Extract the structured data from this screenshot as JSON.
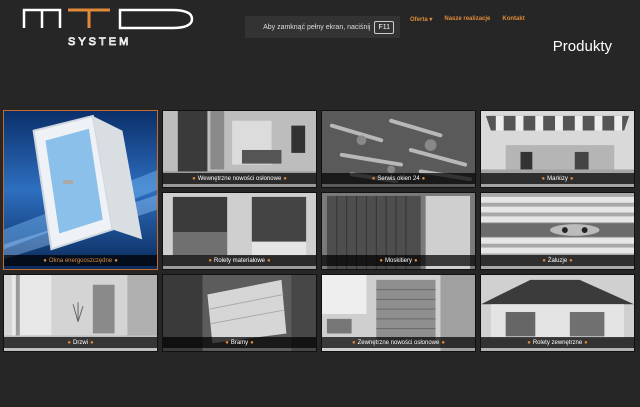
{
  "header": {
    "logo_text": "MTD SYSTEM",
    "fullscreen_notice": "Aby zamknąć pełny ekran, naciśnij",
    "fullscreen_key": "F11",
    "page_title": "Produkty"
  },
  "nav": {
    "items": [
      {
        "label": "Oferta ▾"
      },
      {
        "label": "Nasze realizacje"
      },
      {
        "label": "Kontakt"
      }
    ]
  },
  "colors": {
    "background": "#262626",
    "accent": "#e08a3a"
  },
  "products": [
    {
      "label": "Wewnętrzne nowości osłonowe",
      "active": false
    },
    {
      "label": "Okna energooszczędne",
      "active": true
    },
    {
      "label": "Serwis okien 24",
      "active": false
    },
    {
      "label": "Markizy",
      "active": false
    },
    {
      "label": "Rolety materiałowe",
      "active": false
    },
    {
      "label": "Moskitiery",
      "active": false
    },
    {
      "label": "Żaluzje",
      "active": false
    },
    {
      "label": "Drzwi",
      "active": false
    },
    {
      "label": "Bramy",
      "active": false
    },
    {
      "label": "Zewnętrzne nowości osłonowe",
      "active": false
    },
    {
      "label": "Rolety zewnętrzne",
      "active": false
    }
  ]
}
